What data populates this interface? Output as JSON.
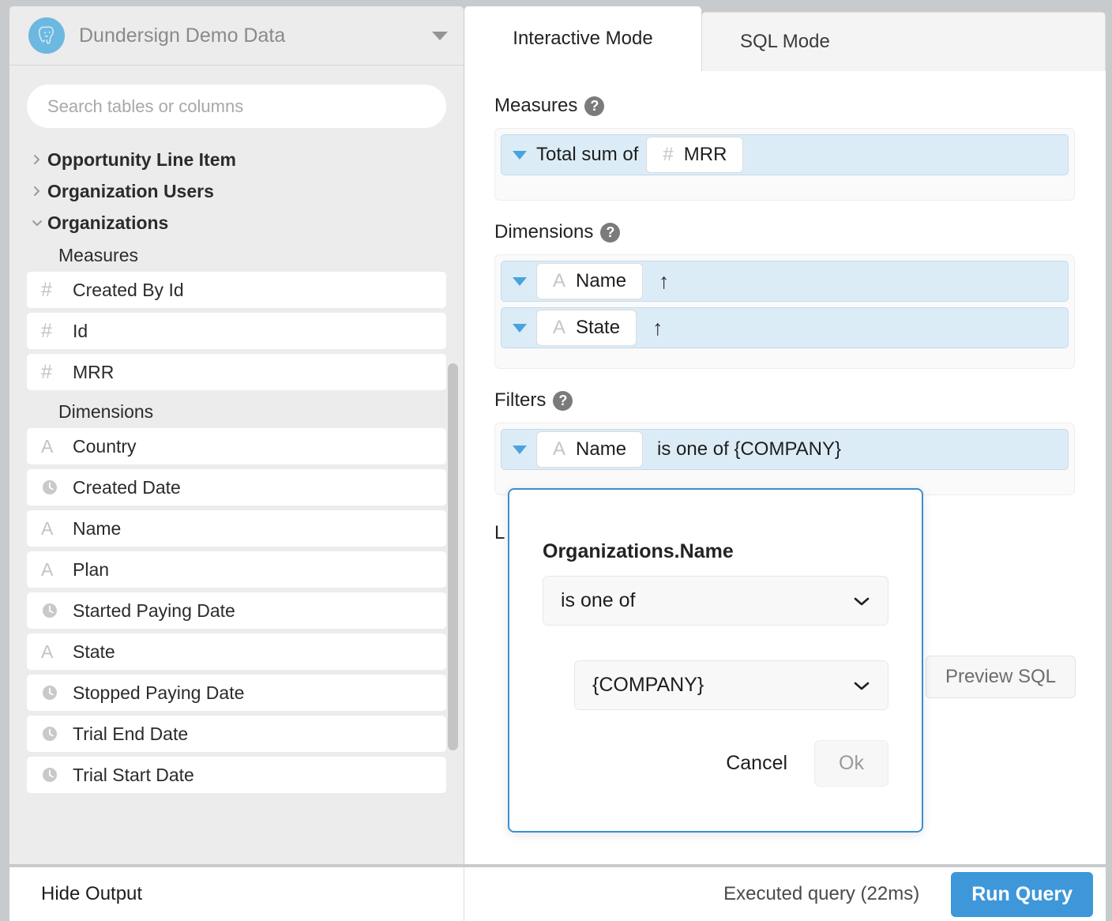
{
  "sidebar": {
    "database": {
      "name": "Dundersign Demo Data",
      "logo_icon": "postgresql-elephant-icon",
      "caret_icon": "chevron-down-icon"
    },
    "search": {
      "placeholder": "Search tables or columns",
      "value": ""
    },
    "tree": [
      {
        "label": "Opportunity Line Item",
        "expanded": false,
        "icon": "chevron-right-icon"
      },
      {
        "label": "Organization Users",
        "expanded": false,
        "icon": "chevron-right-icon"
      },
      {
        "label": "Organizations",
        "expanded": true,
        "icon": "chevron-down-icon"
      }
    ],
    "groups": [
      {
        "label": "Measures",
        "fields": [
          {
            "name": "Created By Id",
            "type": "number",
            "icon": "hash-icon"
          },
          {
            "name": "Id",
            "type": "number",
            "icon": "hash-icon"
          },
          {
            "name": "MRR",
            "type": "number",
            "icon": "hash-icon"
          }
        ]
      },
      {
        "label": "Dimensions",
        "fields": [
          {
            "name": "Country",
            "type": "text",
            "icon": "letter-a-icon"
          },
          {
            "name": "Created Date",
            "type": "date",
            "icon": "clock-icon"
          },
          {
            "name": "Name",
            "type": "text",
            "icon": "letter-a-icon"
          },
          {
            "name": "Plan",
            "type": "text",
            "icon": "letter-a-icon"
          },
          {
            "name": "Started Paying Date",
            "type": "date",
            "icon": "clock-icon"
          },
          {
            "name": "State",
            "type": "text",
            "icon": "letter-a-icon"
          },
          {
            "name": "Stopped Paying Date",
            "type": "date",
            "icon": "clock-icon"
          },
          {
            "name": "Trial End Date",
            "type": "date",
            "icon": "clock-icon"
          },
          {
            "name": "Trial Start Date",
            "type": "date",
            "icon": "clock-icon"
          }
        ]
      }
    ]
  },
  "tabs": [
    {
      "label": "Interactive Mode",
      "active": true
    },
    {
      "label": "SQL Mode",
      "active": false
    }
  ],
  "builder": {
    "measures": {
      "label": "Measures",
      "help_icon": "question-mark-icon",
      "items": [
        {
          "aggregation": "Total sum of",
          "field": "MRR",
          "field_type": "number",
          "field_icon": "hash-icon",
          "caret_icon": "caret-down-icon"
        }
      ]
    },
    "dimensions": {
      "label": "Dimensions",
      "help_icon": "question-mark-icon",
      "items": [
        {
          "field": "Name",
          "field_type": "text",
          "field_icon": "letter-a-icon",
          "sort": "↑",
          "caret_icon": "caret-down-icon"
        },
        {
          "field": "State",
          "field_type": "text",
          "field_icon": "letter-a-icon",
          "sort": "↑",
          "caret_icon": "caret-down-icon"
        }
      ]
    },
    "filters": {
      "label": "Filters",
      "help_icon": "question-mark-icon",
      "items": [
        {
          "field": "Name",
          "field_type": "text",
          "field_icon": "letter-a-icon",
          "expression": "is one of {COMPANY}",
          "caret_icon": "caret-down-icon"
        }
      ]
    },
    "limit_label": "L",
    "preview_sql_label": "Preview SQL"
  },
  "modal": {
    "title": "Organizations.Name",
    "operator": {
      "value": "is one of",
      "chevron_icon": "chevron-down-icon"
    },
    "value": {
      "value": "{COMPANY}",
      "chevron_icon": "chevron-down-icon"
    },
    "cancel_label": "Cancel",
    "ok_label": "Ok"
  },
  "bottom_bar": {
    "hide_output_label": "Hide Output",
    "status": "Executed query (22ms)",
    "run_query_label": "Run Query",
    "run_query_color": "#3d97d9"
  }
}
